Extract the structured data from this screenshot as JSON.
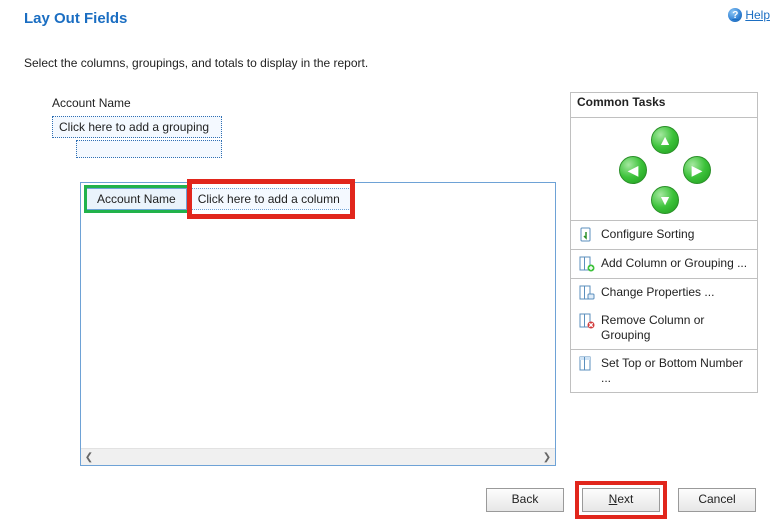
{
  "header": {
    "title": "Lay Out Fields",
    "help_label": "Help"
  },
  "instruction": "Select the columns, groupings, and totals to display in the report.",
  "grouping": {
    "field_label": "Account Name",
    "placeholder": "Click here to add a grouping"
  },
  "columns": {
    "first": "Account Name",
    "placeholder": "Click here to add a column"
  },
  "sidebar": {
    "header": "Common Tasks",
    "tasks": {
      "configure_sorting": "Configure Sorting",
      "add_column_or_grouping": "Add Column or Grouping ...",
      "change_properties": "Change Properties ...",
      "remove_column_or_grouping": "Remove Column or Grouping",
      "set_top_or_bottom_number": "Set Top or Bottom Number ..."
    }
  },
  "footer": {
    "back": "Back",
    "next": "ext",
    "cancel": "Cancel"
  }
}
